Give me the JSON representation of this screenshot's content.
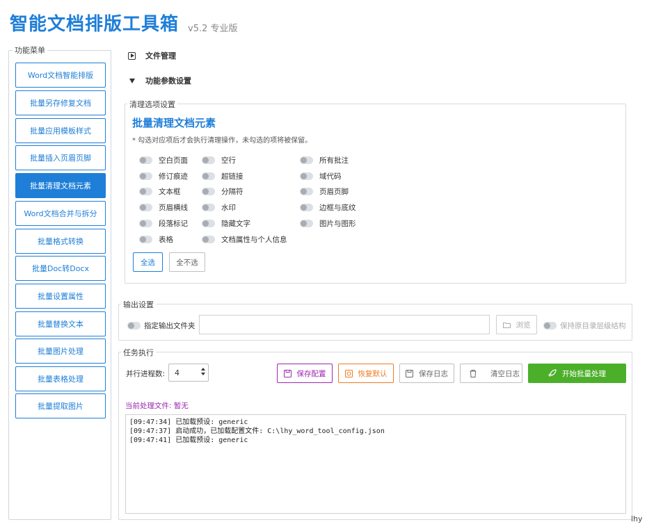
{
  "header": {
    "title": "智能文档排版工具箱",
    "version": "v5.2 专业版"
  },
  "sidebar": {
    "legend": "功能菜单",
    "items": [
      {
        "label": "Word文档智能排版",
        "active": false
      },
      {
        "label": "批量另存修复文档",
        "active": false
      },
      {
        "label": "批量应用模板样式",
        "active": false
      },
      {
        "label": "批量插入页眉页脚",
        "active": false
      },
      {
        "label": "批量清理文档元素",
        "active": true
      },
      {
        "label": "Word文档合并与拆分",
        "active": false
      },
      {
        "label": "批量格式转换",
        "active": false
      },
      {
        "label": "批量Doc转Docx",
        "active": false
      },
      {
        "label": "批量设置属性",
        "active": false
      },
      {
        "label": "批量替换文本",
        "active": false
      },
      {
        "label": "批量图片处理",
        "active": false
      },
      {
        "label": "批量表格处理",
        "active": false
      },
      {
        "label": "批量提取图片",
        "active": false
      }
    ]
  },
  "sections": {
    "file_management": "文件管理",
    "param_settings": "功能参数设置"
  },
  "clean_options": {
    "legend": "清理选项设置",
    "title": "批量清理文档元素",
    "hint": "* 勾选对应项后才会执行清理操作，未勾选的项将被保留。",
    "options": [
      {
        "label": "空白页面",
        "checked": false
      },
      {
        "label": "空行",
        "checked": false
      },
      {
        "label": "所有批注",
        "checked": false
      },
      {
        "label": "修订痕迹",
        "checked": false
      },
      {
        "label": "超链接",
        "checked": false
      },
      {
        "label": "域代码",
        "checked": false
      },
      {
        "label": "文本框",
        "checked": false
      },
      {
        "label": "分隔符",
        "checked": false
      },
      {
        "label": "页眉页脚",
        "checked": false
      },
      {
        "label": "页眉横线",
        "checked": false
      },
      {
        "label": "水印",
        "checked": false
      },
      {
        "label": "边框与底纹",
        "checked": false
      },
      {
        "label": "段落标记",
        "checked": false
      },
      {
        "label": "隐藏文字",
        "checked": false
      },
      {
        "label": "图片与图形",
        "checked": false
      },
      {
        "label": "表格",
        "checked": false
      },
      {
        "label": "文档属性与个人信息",
        "checked": false
      }
    ],
    "select_all": "全选",
    "select_none": "全不选"
  },
  "output": {
    "legend": "输出设置",
    "specify_folder_label": "指定输出文件夹",
    "folder_value": "",
    "browse_label": "浏览",
    "keep_structure_label": "保持原目录层级结构"
  },
  "task": {
    "legend": "任务执行",
    "parallel_label": "并行进程数:",
    "parallel_value": "4",
    "save_config": "保存配置",
    "restore_default": "恢复默认",
    "save_log": "保存日志",
    "clear_log": "清空日志",
    "start_batch": "开始批量处理",
    "current_file_label": "当前处理文件: 暂无",
    "log_lines": [
      "[09:47:34] 已加载预设: generic",
      "[09:47:37] 启动成功，已加载配置文件: C:\\lhy_word_tool_config.json",
      "[09:47:41] 已加载预设: generic"
    ]
  },
  "footer": {
    "signature": "lhy"
  },
  "colors": {
    "accent": "#1e7ed8",
    "purple": "#9c27b0",
    "orange": "#ef7b22",
    "green": "#4caf2a"
  }
}
